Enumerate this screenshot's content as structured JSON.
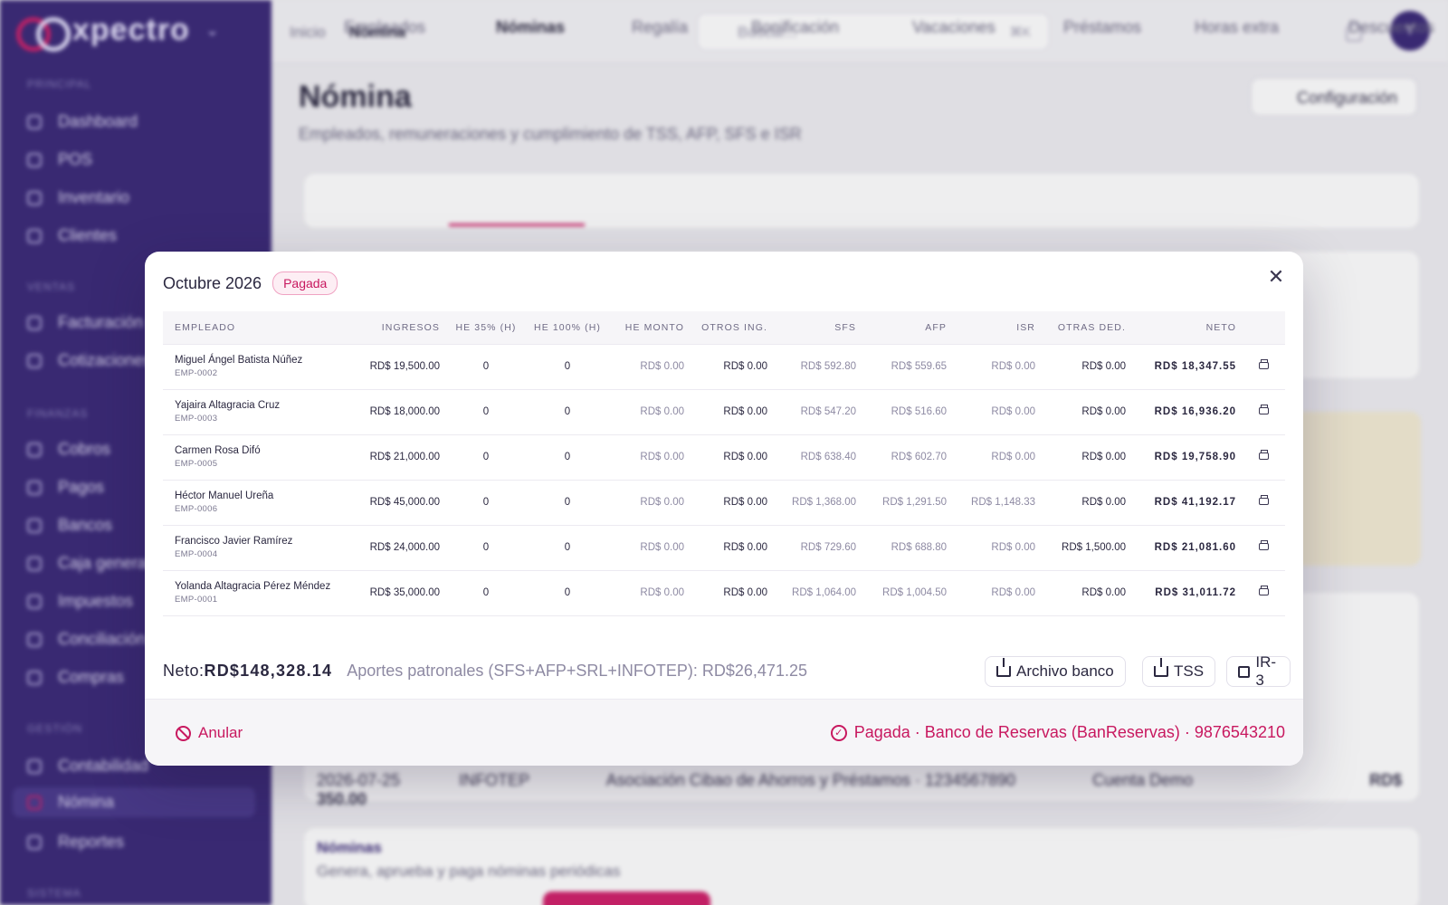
{
  "app": {
    "logo_text": "xpectro",
    "sidebar": {
      "sections": [
        "PRINCIPAL",
        "VENTAS",
        "FINANZAS",
        "GESTIÓN",
        "SISTEMA"
      ],
      "items": [
        "Dashboard",
        "POS",
        "Inventario",
        "Clientes",
        "Facturación",
        "Cotizaciones",
        "Cobros",
        "Pagos",
        "Bancos",
        "Caja general",
        "Impuestos",
        "Conciliación",
        "Compras",
        "Contabilidad",
        "Nómina",
        "Reportes"
      ]
    },
    "breadcrumb": {
      "root": "Inicio",
      "current": "Nómina"
    },
    "search": {
      "placeholder": "Buscar...",
      "shortcut": "⌘K"
    },
    "avatar": "Y",
    "page_title": "Nómina",
    "page_subtitle": "Empleados, remuneraciones y cumplimiento de TSS, AFP, SFS e ISR",
    "config_button": "Configuración",
    "tabs": [
      "Empleados",
      "Nóminas",
      "Regalía",
      "Bonificación",
      "Vacaciones",
      "Préstamos",
      "Horas extra",
      "Descuentos"
    ],
    "active_tab": "Nóminas",
    "bg_rows": [
      {
        "date": "2026-07-25",
        "code": "INFOTEP",
        "desc": "Asociación Cibao de Ahorros y Préstamos · 1234567890",
        "account": "Cuenta Demo",
        "amount": "RD$ 350.00"
      }
    ],
    "bg_section_title": "Nóminas",
    "bg_section_sub": "Genera, aprueba y paga nóminas periódicas"
  },
  "modal": {
    "title": "Octubre 2026",
    "status_badge": "Pagada",
    "close_icon": "close-icon",
    "columns": [
      "EMPLEADO",
      "INGRESOS",
      "HE 35% (H)",
      "HE 100% (H)",
      "HE MONTO",
      "OTROS ING.",
      "SFS",
      "AFP",
      "ISR",
      "OTRAS DED.",
      "NETO"
    ],
    "rows": [
      {
        "name": "Miguel Ángel Batista Núñez",
        "id": "EMP-0002",
        "ingresos": "RD$ 19,500.00",
        "he35": "0",
        "he100": "0",
        "he_monto": "RD$ 0.00",
        "otros_ing": "RD$ 0.00",
        "sfs": "RD$ 592.80",
        "afp": "RD$ 559.65",
        "isr": "RD$ 0.00",
        "otras_ded": "RD$ 0.00",
        "neto": "RD$ 18,347.55"
      },
      {
        "name": "Yajaira Altagracia Cruz",
        "id": "EMP-0003",
        "ingresos": "RD$ 18,000.00",
        "he35": "0",
        "he100": "0",
        "he_monto": "RD$ 0.00",
        "otros_ing": "RD$ 0.00",
        "sfs": "RD$ 547.20",
        "afp": "RD$ 516.60",
        "isr": "RD$ 0.00",
        "otras_ded": "RD$ 0.00",
        "neto": "RD$ 16,936.20"
      },
      {
        "name": "Carmen Rosa Difó",
        "id": "EMP-0005",
        "ingresos": "RD$ 21,000.00",
        "he35": "0",
        "he100": "0",
        "he_monto": "RD$ 0.00",
        "otros_ing": "RD$ 0.00",
        "sfs": "RD$ 638.40",
        "afp": "RD$ 602.70",
        "isr": "RD$ 0.00",
        "otras_ded": "RD$ 0.00",
        "neto": "RD$ 19,758.90"
      },
      {
        "name": "Héctor Manuel Ureña",
        "id": "EMP-0006",
        "ingresos": "RD$ 45,000.00",
        "he35": "0",
        "he100": "0",
        "he_monto": "RD$ 0.00",
        "otros_ing": "RD$ 0.00",
        "sfs": "RD$ 1,368.00",
        "afp": "RD$ 1,291.50",
        "isr": "RD$ 1,148.33",
        "otras_ded": "RD$ 0.00",
        "neto": "RD$ 41,192.17"
      },
      {
        "name": "Francisco Javier Ramírez",
        "id": "EMP-0004",
        "ingresos": "RD$ 24,000.00",
        "he35": "0",
        "he100": "0",
        "he_monto": "RD$ 0.00",
        "otros_ing": "RD$ 0.00",
        "sfs": "RD$ 729.60",
        "afp": "RD$ 688.80",
        "isr": "RD$ 0.00",
        "otras_ded": "RD$ 1,500.00",
        "neto": "RD$ 21,081.60"
      },
      {
        "name": "Yolanda Altagracia Pérez Méndez",
        "id": "EMP-0001",
        "ingresos": "RD$ 35,000.00",
        "he35": "0",
        "he100": "0",
        "he_monto": "RD$ 0.00",
        "otros_ing": "RD$ 0.00",
        "sfs": "RD$ 1,064.00",
        "afp": "RD$ 1,004.50",
        "isr": "RD$ 0.00",
        "otras_ded": "RD$ 0.00",
        "neto": "RD$ 31,011.72"
      }
    ],
    "footer": {
      "neto_label": "Neto:",
      "neto_value": "RD$148,328.14",
      "aportes": "Aportes patronales (SFS+AFP+SRL+INFOTEP): RD$26,471.25",
      "btn_bank": "Archivo banco",
      "btn_tss": "TSS",
      "btn_ir3": "IR-3"
    },
    "bottom": {
      "anular": "Anular",
      "paid_status": "Pagada · Banco de Reservas (BanReservas) · 9876543210"
    }
  },
  "colors": {
    "accent": "#c8185f",
    "sidebar": "#3b2a78"
  }
}
